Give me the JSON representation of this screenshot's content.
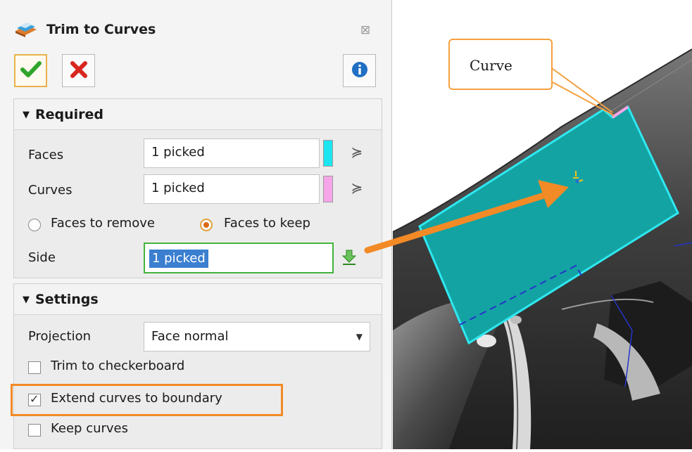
{
  "dialog": {
    "title": "Trim to Curves",
    "close_glyph": "⊠",
    "icons": {
      "title": "trim-icon",
      "ok": "check-icon",
      "cancel": "x-icon",
      "info": "info-icon"
    }
  },
  "required": {
    "header": "Required",
    "faces_label": "Faces",
    "faces_value": "1 picked",
    "faces_color": "#1de5f0",
    "curves_label": "Curves",
    "curves_value": "1 picked",
    "curves_color": "#f6a6e8",
    "radio_remove": "Faces to remove",
    "radio_keep": "Faces to keep",
    "radio_selected": "Faces to keep",
    "side_label": "Side",
    "side_value": "1 picked"
  },
  "settings": {
    "header": "Settings",
    "projection_label": "Projection",
    "projection_value": "Face normal",
    "trim_checkerboard": "Trim to checkerboard",
    "trim_checkerboard_checked": false,
    "extend_curves": "Extend curves to boundary",
    "extend_curves_checked": true,
    "keep_curves": "Keep curves",
    "keep_curves_checked": false
  },
  "viewport": {
    "callout_text": "Curve",
    "face_color": "#14a3a3",
    "edge_color": "#2ee8f0",
    "accent_color": "#f28a25"
  }
}
